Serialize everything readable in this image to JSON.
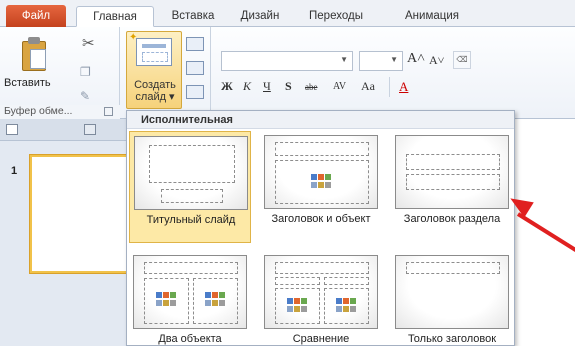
{
  "tabs": [
    {
      "label": "Файл"
    },
    {
      "label": "Главная"
    },
    {
      "label": "Вставка"
    },
    {
      "label": "Дизайн"
    },
    {
      "label": "Переходы"
    },
    {
      "label": "Анимация"
    }
  ],
  "clipboard": {
    "paste_label": "Вставить",
    "group_label": "Буфер обме..."
  },
  "slides": {
    "new_slide_line1": "Создать",
    "new_slide_line2": "слайд ▾"
  },
  "font": {
    "grow_glyph": "A˄",
    "shrink_glyph": "A˅",
    "bold": "Ж",
    "italic": "К",
    "underline": "Ч",
    "shadow": "S",
    "strike": "abe",
    "spacing": "AV",
    "case": "Aa",
    "color": "A"
  },
  "slide_pane": {
    "slide_number": "1"
  },
  "gallery": {
    "title": "Исполнительная",
    "layouts": [
      {
        "label": "Титульный слайд"
      },
      {
        "label": "Заголовок и объект"
      },
      {
        "label": "Заголовок раздела"
      },
      {
        "label": "Два объекта"
      },
      {
        "label": "Сравнение"
      },
      {
        "label": "Только заголовок"
      }
    ],
    "selected_index": 0
  },
  "colors": {
    "file_tab": "#d2502a",
    "selection": "#fde9a6",
    "arrow": "#e02020"
  }
}
